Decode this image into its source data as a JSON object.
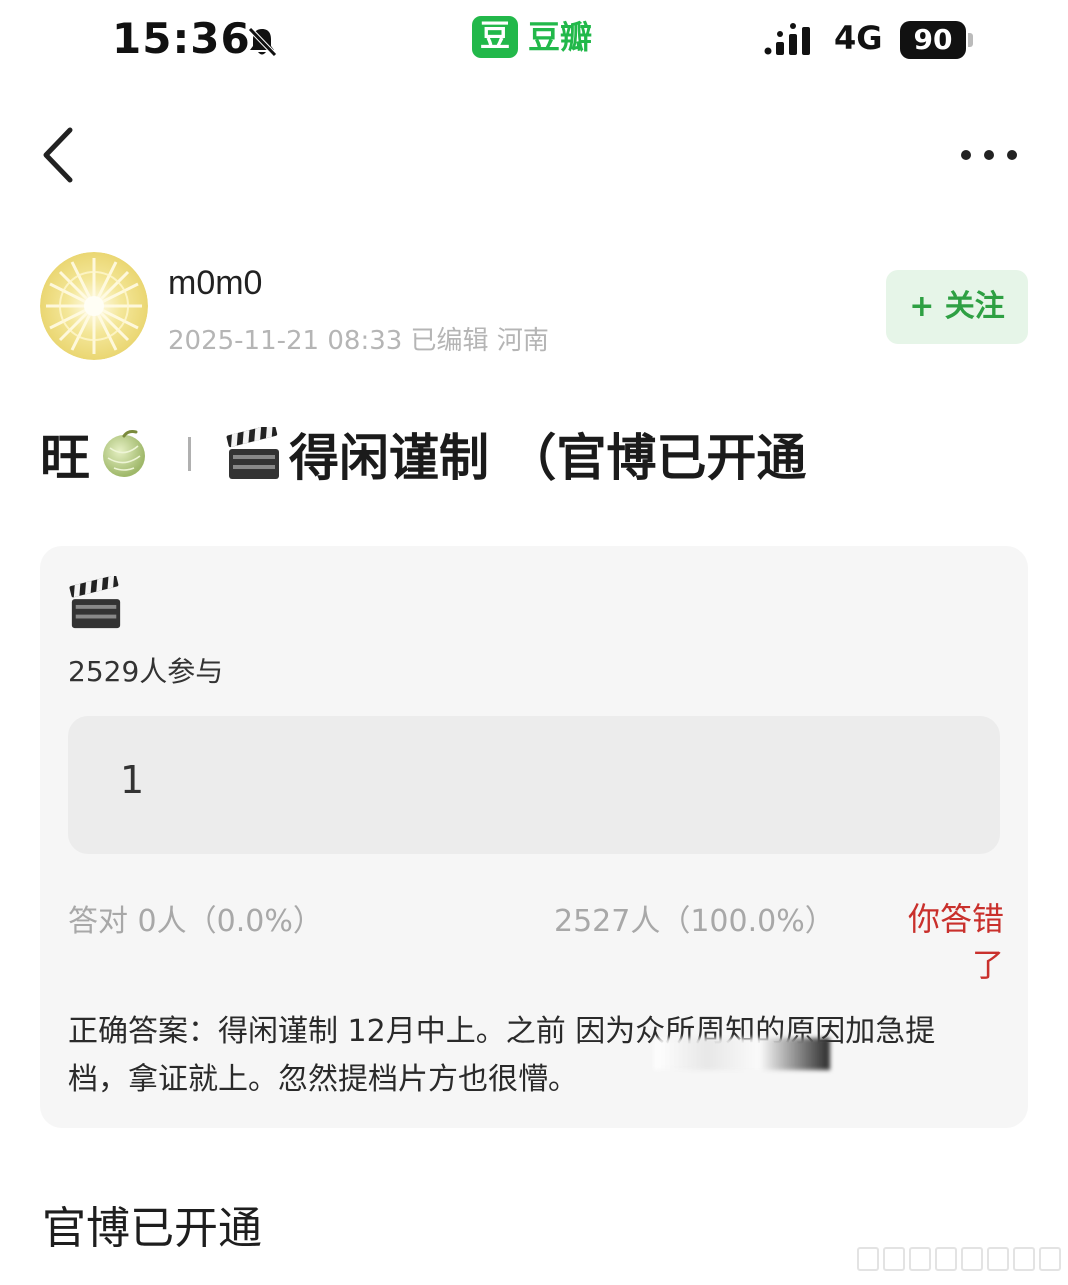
{
  "status_bar": {
    "time": "15:36",
    "app_name": "豆瓣",
    "app_badge": "豆",
    "network": "4G",
    "battery": "90"
  },
  "author": {
    "name": "m0m0",
    "meta": "2025-11-21 08:33  已编辑  河南",
    "follow_label": "+ 关注"
  },
  "post": {
    "title_prefix": "旺",
    "title_main": "得闲谨制 （官博已开通",
    "body": "官博已开通"
  },
  "quiz": {
    "participants": "2529人参与",
    "option_label": "1",
    "correct_stat": "答对  0人（0.0%）",
    "wrong_stat": "2527人（100.0%）",
    "wrong_badge": "你答错了",
    "answer": "正确答案：得闲谨制 12月中上。之前                    因为众所周知的原因加急提档，拿证就上。忽然提档片方也很懵。"
  },
  "colors": {
    "brand_green": "#22b84a",
    "follow_text": "#2ea043",
    "follow_bg": "#e6f5e8",
    "error_red": "#c9302c",
    "card_bg": "#f6f6f6"
  },
  "icons": [
    "bell-off-icon",
    "signal-icon",
    "back-chevron-icon",
    "more-icon",
    "melon-icon",
    "clapper-icon"
  ]
}
